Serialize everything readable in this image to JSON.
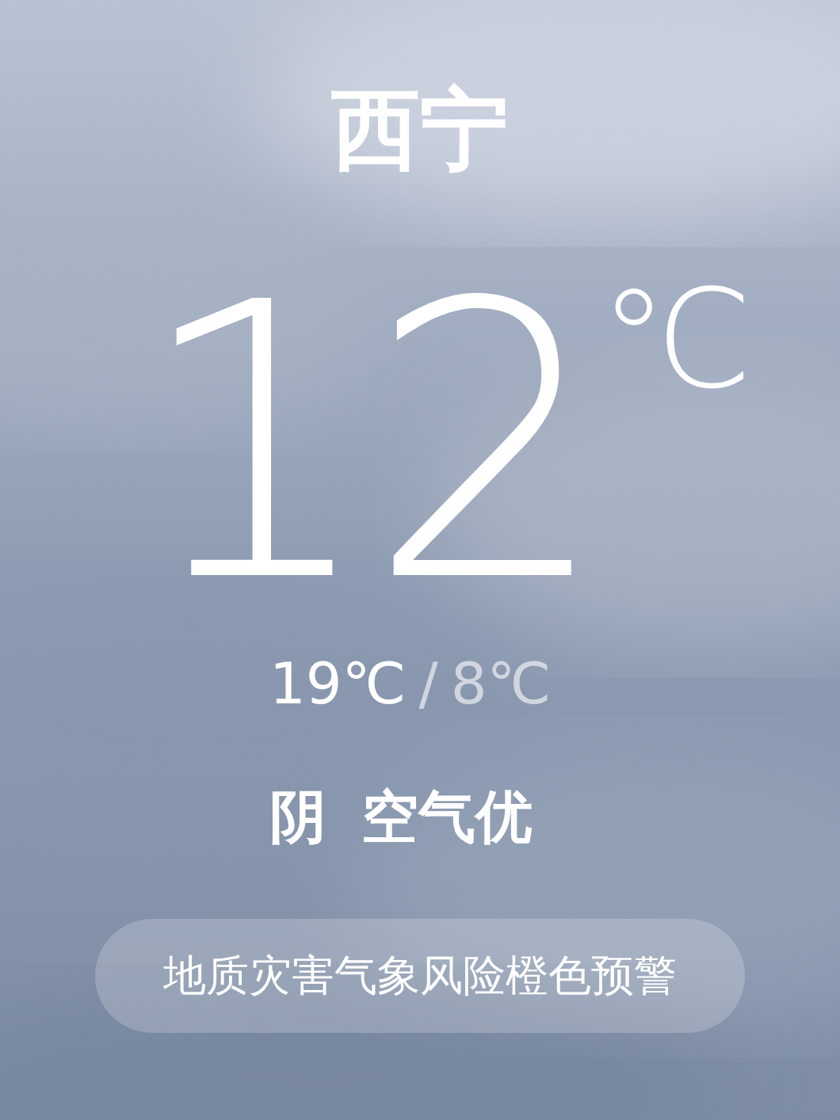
{
  "city": "西宁",
  "temperature": {
    "value": "12",
    "unit": "℃"
  },
  "range": {
    "high": "19℃",
    "separator": "/",
    "low": "8℃"
  },
  "condition": "阴",
  "air_quality": "空气优",
  "alert": "地质灾害气象风险橙色预警"
}
